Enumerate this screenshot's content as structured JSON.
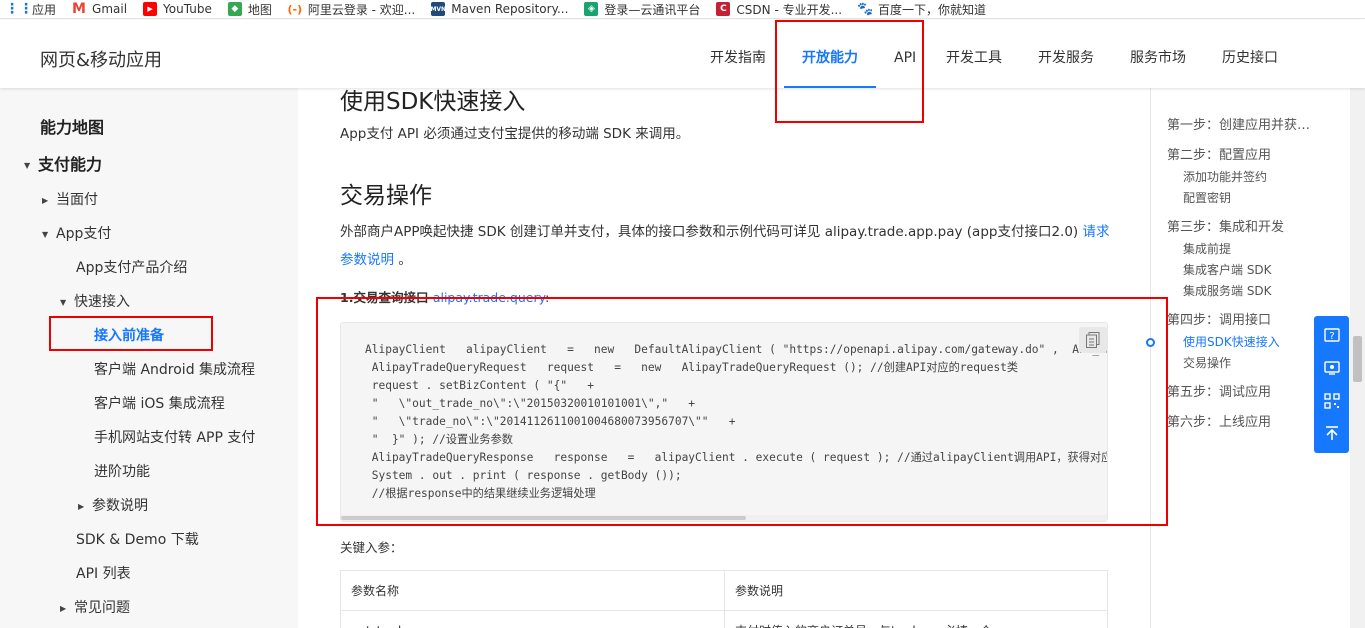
{
  "bookmarks": [
    {
      "label": "应用",
      "icon": "apps-grid-icon",
      "color": "#1a73e8"
    },
    {
      "label": "Gmail",
      "icon": "gmail-icon",
      "color": "#ea4335"
    },
    {
      "label": "YouTube",
      "icon": "youtube-icon",
      "color": "#ff0000"
    },
    {
      "label": "地图",
      "icon": "maps-icon",
      "color": "#34a853"
    },
    {
      "label": "阿里云登录 - 欢迎...",
      "icon": "aliyun-icon",
      "color": "#ff6a00"
    },
    {
      "label": "Maven Repository...",
      "icon": "maven-icon",
      "color": "#1e4b7a"
    },
    {
      "label": "登录—云通讯平台",
      "icon": "cloud-sms-icon",
      "color": "#1aa36f"
    },
    {
      "label": "CSDN - 专业开发...",
      "icon": "csdn-icon",
      "color": "#c32136"
    },
    {
      "label": "百度一下，你就知道",
      "icon": "baidu-icon",
      "color": "#3245df"
    }
  ],
  "header": {
    "brand": "网页&移动应用",
    "tabs": [
      "开发指南",
      "开放能力",
      "API",
      "开发工具",
      "开发服务",
      "服务市场",
      "历史接口"
    ],
    "active_tab": "开放能力",
    "accent": "#1677ff"
  },
  "sidebar": {
    "items": [
      {
        "label": "能力地图",
        "level": 0
      },
      {
        "label": "支付能力",
        "level": 0,
        "arrow": "down"
      },
      {
        "label": "当面付",
        "level": 1,
        "arrow": "right"
      },
      {
        "label": "App支付",
        "level": 1,
        "arrow": "down"
      },
      {
        "label": "App支付产品介绍",
        "level": 2
      },
      {
        "label": "快速接入",
        "level": 2,
        "arrow": "down"
      },
      {
        "label": "接入前准备",
        "level": 3,
        "selected": true
      },
      {
        "label": "客户端 Android 集成流程",
        "level": 3
      },
      {
        "label": "客户端 iOS 集成流程",
        "level": 3
      },
      {
        "label": "手机网站支付转 APP 支付",
        "level": 3
      },
      {
        "label": "进阶功能",
        "level": 3
      },
      {
        "label": "参数说明",
        "level": 3,
        "arrow": "right"
      },
      {
        "label": "SDK & Demo 下载",
        "level": 2
      },
      {
        "label": "API 列表",
        "level": 2
      },
      {
        "label": "常见问题",
        "level": 1,
        "arrow": "right"
      }
    ]
  },
  "main": {
    "heading_top": "使用SDK快速接入",
    "intro": "App支付 API 必须通过支付宝提供的移动端 SDK 来调用。",
    "section_title": "交易操作",
    "para_text": "外部商户APP唤起快捷 SDK 创建订单并支付，具体的接口参数和示例代码可详见 alipay.trade.app.pay (app支付接口2.0) ",
    "para_link": "请求参数说明",
    "para_end": " 。",
    "query_label": "1.交易查询接口 ",
    "query_link": "alipay.trade.query",
    "query_end": ":",
    "key_params": "关键入参：",
    "table_headers": [
      "参数名称",
      "参数说明"
    ],
    "table_partial_row": [
      "out_trade_no",
      "支付时传入的商户订单号，与trade_no必填一个"
    ]
  },
  "code": {
    "lines": [
      "AlipayClient   alipayClient   =   new   DefaultAlipayClient ( \"https://openapi.alipay.com/gateway.do\" ,  APP_ID",
      " AlipayTradeQueryRequest   request   =   new   AlipayTradeQueryRequest (); //创建API对应的request类",
      " request . setBizContent ( \"{\"   +",
      " \"   \\\"out_trade_no\\\":\\\"20150320010101001\\\",\"   +",
      " \"   \\\"trade_no\\\":\\\"2014112611001004680073956707\\\"\"   +",
      " \"  }\" ); //设置业务参数",
      " AlipayTradeQueryResponse   response   =   alipayClient . execute ( request ); //通过alipayClient调用API，获得对应的response类",
      " System . out . print ( response . getBody ());",
      " //根据response中的结果继续业务逻辑处理"
    ]
  },
  "toc": {
    "items": [
      {
        "label": "第一步：创建应用并获…",
        "sub": false
      },
      {
        "label": "第二步：配置应用",
        "sub": false
      },
      {
        "label": "添加功能并签约",
        "sub": true
      },
      {
        "label": "配置密钥",
        "sub": true
      },
      {
        "label": "第三步：集成和开发",
        "sub": false
      },
      {
        "label": "集成前提",
        "sub": true
      },
      {
        "label": "集成客户端 SDK",
        "sub": true
      },
      {
        "label": "集成服务端 SDK",
        "sub": true
      },
      {
        "label": "第四步：调用接口",
        "sub": false
      },
      {
        "label": "使用SDK快速接入",
        "sub": true,
        "active": true
      },
      {
        "label": "交易操作",
        "sub": true
      },
      {
        "label": "第五步：调试应用",
        "sub": false
      },
      {
        "label": "第六步：上线应用",
        "sub": false
      }
    ]
  },
  "float_icons": [
    "question-icon",
    "feedback-icon",
    "qrcode-icon",
    "back-to-top-icon"
  ],
  "highlight_color": "#e00000"
}
